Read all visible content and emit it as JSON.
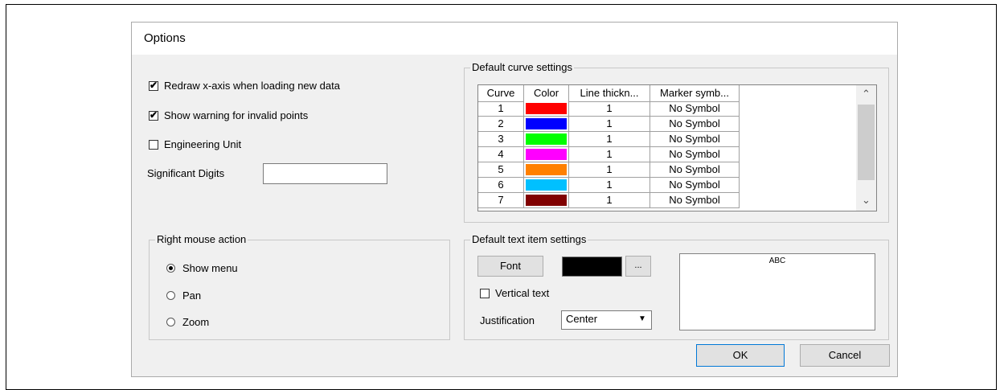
{
  "dialog": {
    "title": "Options"
  },
  "general": {
    "redraw_label": "Redraw x-axis when loading new data",
    "redraw_checked": true,
    "warning_label": "Show warning for invalid points",
    "warning_checked": true,
    "engineering_label": "Engineering Unit",
    "engineering_checked": false,
    "sig_digits_label": "Significant Digits",
    "sig_digits_value": ""
  },
  "right_mouse": {
    "title": "Right mouse action",
    "options": [
      {
        "label": "Show menu",
        "selected": true
      },
      {
        "label": "Pan",
        "selected": false
      },
      {
        "label": "Zoom",
        "selected": false
      }
    ]
  },
  "curves": {
    "title": "Default curve settings",
    "headers": [
      "Curve",
      "Color",
      "Line thickn...",
      "Marker symb..."
    ],
    "rows": [
      {
        "curve": "1",
        "color": "#ff0000",
        "thickness": "1",
        "marker": "No Symbol"
      },
      {
        "curve": "2",
        "color": "#0000ff",
        "thickness": "1",
        "marker": "No Symbol"
      },
      {
        "curve": "3",
        "color": "#00ff00",
        "thickness": "1",
        "marker": "No Symbol"
      },
      {
        "curve": "4",
        "color": "#ff00ff",
        "thickness": "1",
        "marker": "No Symbol"
      },
      {
        "curve": "5",
        "color": "#ff8000",
        "thickness": "1",
        "marker": "No Symbol"
      },
      {
        "curve": "6",
        "color": "#00c0ff",
        "thickness": "1",
        "marker": "No Symbol"
      },
      {
        "curve": "7",
        "color": "#800000",
        "thickness": "1",
        "marker": "No Symbol"
      }
    ]
  },
  "text_item": {
    "title": "Default text item settings",
    "font_button": "Font",
    "color": "#000000",
    "ellipsis_button": "...",
    "vertical_label": "Vertical text",
    "vertical_checked": false,
    "justification_label": "Justification",
    "justification_value": "Center",
    "preview_text": "ABC"
  },
  "buttons": {
    "ok": "OK",
    "cancel": "Cancel"
  }
}
